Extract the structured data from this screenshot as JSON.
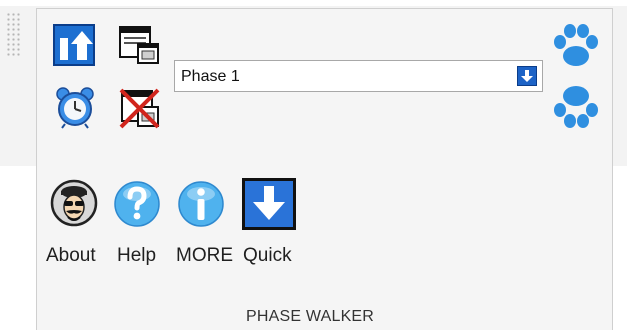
{
  "phase_selector": {
    "value": "Phase 1"
  },
  "tools": {
    "about_label": "About",
    "help_label": "Help",
    "more_label": "MORE",
    "quick_label": "Quick"
  },
  "group": {
    "label": "PHASE WALKER"
  },
  "icons": {
    "upload": "upload-arrow-icon",
    "alarm": "alarm-clock-icon",
    "view": "window-view-icon",
    "delete_view": "window-delete-icon",
    "paw_up": "paw-up-icon",
    "paw_down": "paw-down-icon",
    "about": "spy-face-icon",
    "help": "question-mark-icon",
    "info": "info-icon",
    "quick": "down-arrow-icon"
  },
  "colors": {
    "accent_blue": "#1d63c6",
    "paw_blue": "#2f8fe0",
    "delete_red": "#d1251d"
  }
}
